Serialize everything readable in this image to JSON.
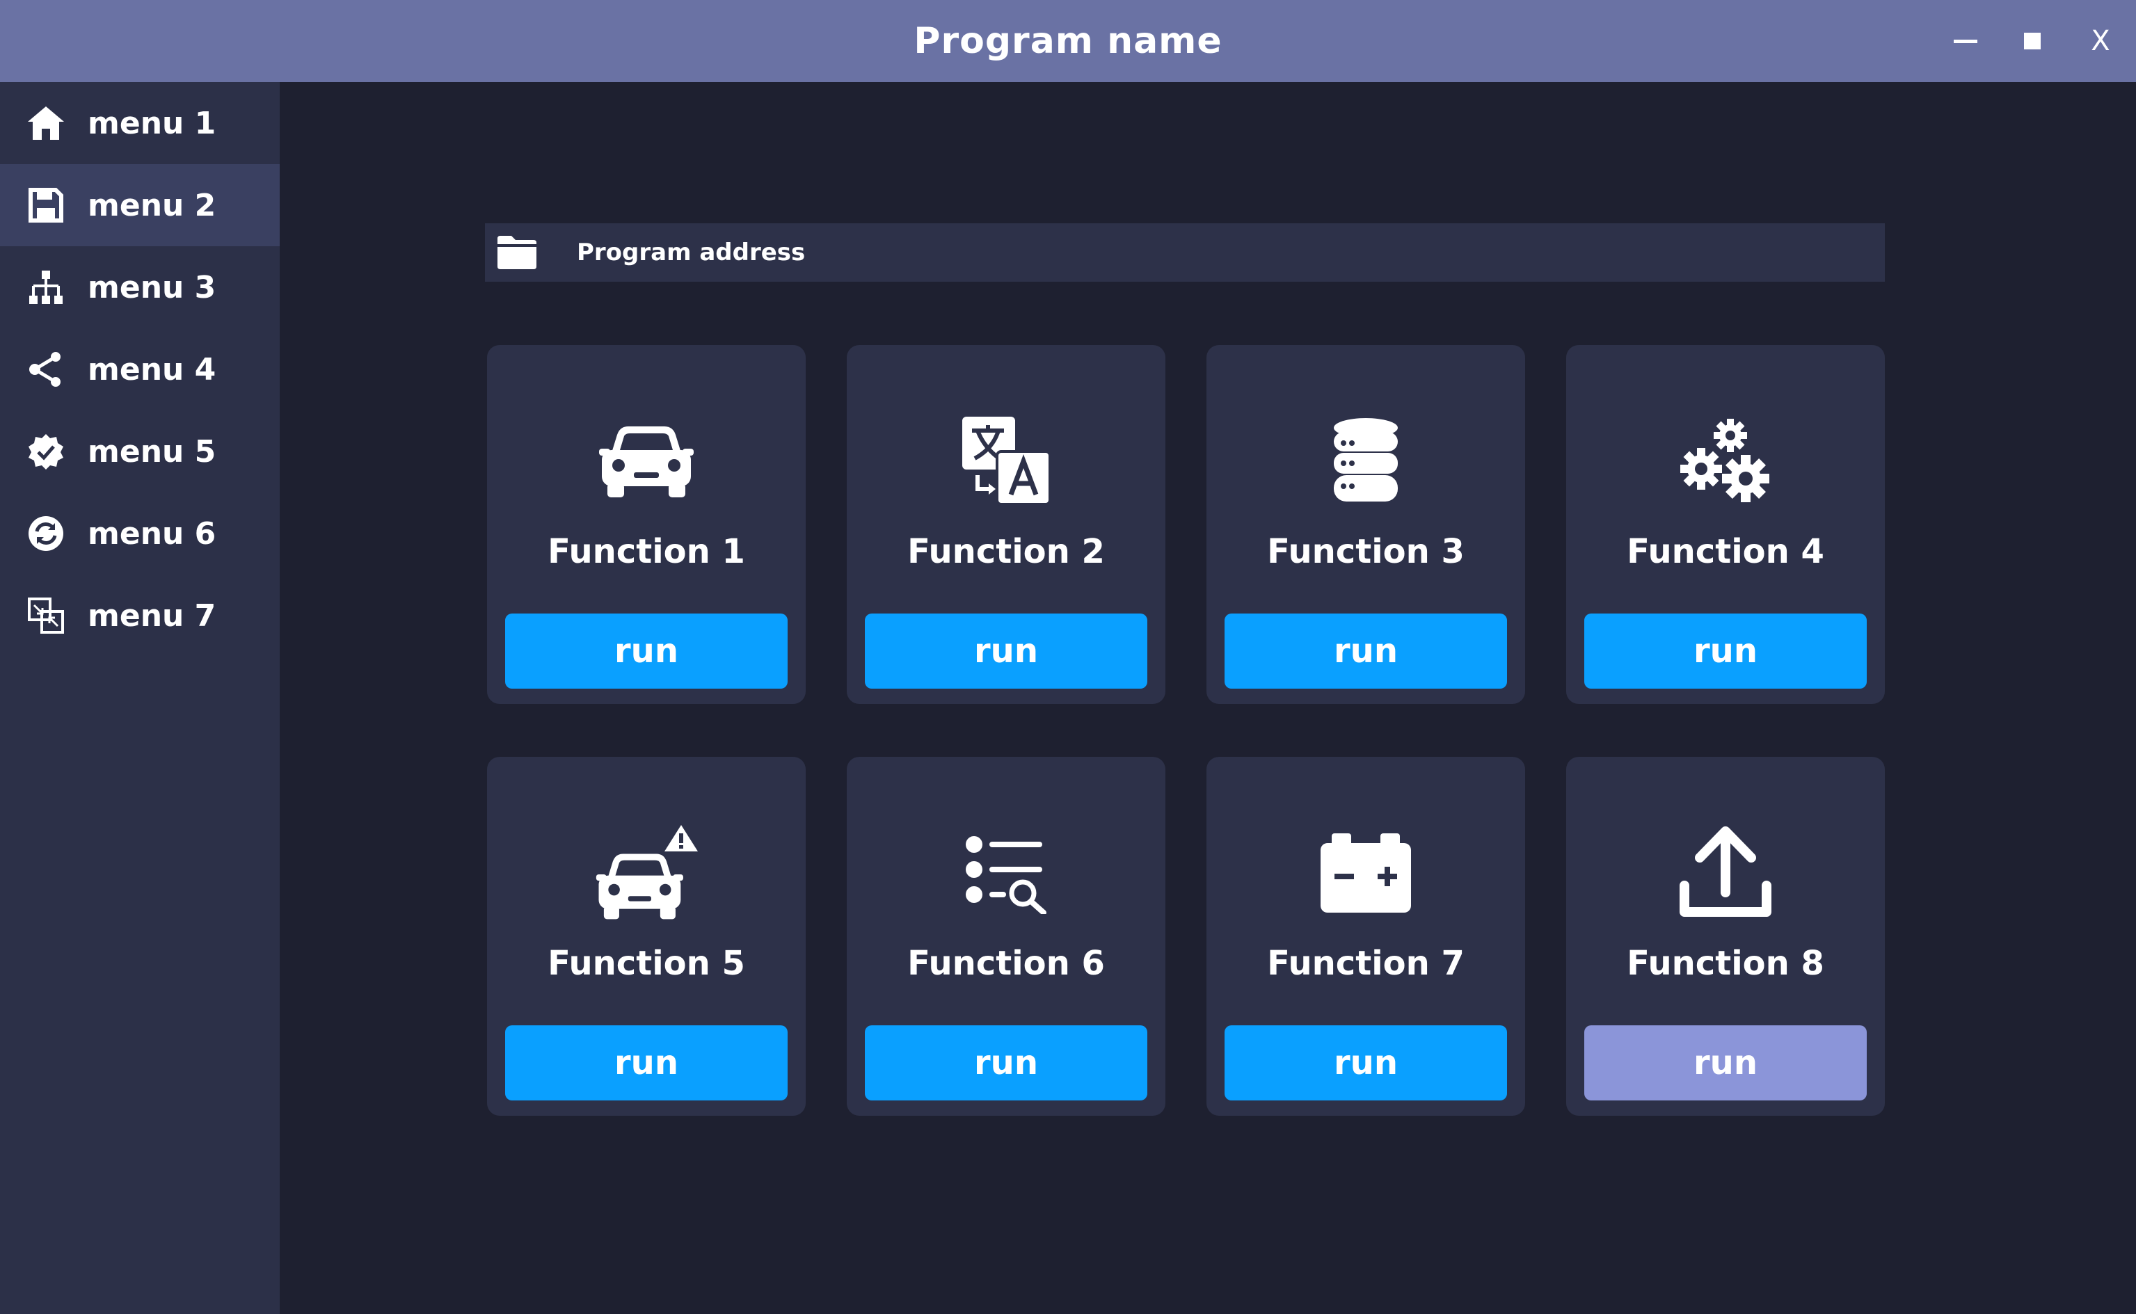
{
  "window": {
    "title": "Program name",
    "controls": {
      "minimize": "—",
      "maximize": "■",
      "close": "X"
    }
  },
  "sidebar": {
    "items": [
      {
        "label": "menu 1",
        "icon": "home-icon",
        "active": false
      },
      {
        "label": "menu 2",
        "icon": "save-icon",
        "active": true
      },
      {
        "label": "menu 3",
        "icon": "sitemap-icon",
        "active": false
      },
      {
        "label": "menu 4",
        "icon": "share-icon",
        "active": false
      },
      {
        "label": "menu 5",
        "icon": "verified-badge-icon",
        "active": false
      },
      {
        "label": "menu 6",
        "icon": "sync-icon",
        "active": false
      },
      {
        "label": "menu 7",
        "icon": "transfer-icon",
        "active": false
      }
    ]
  },
  "address_bar": {
    "icon": "folder-icon",
    "text": "Program address"
  },
  "functions": [
    {
      "label": "Function 1",
      "icon": "car-icon",
      "button": "run",
      "enabled": true
    },
    {
      "label": "Function 2",
      "icon": "translate-icon",
      "button": "run",
      "enabled": true
    },
    {
      "label": "Function 3",
      "icon": "database-icon",
      "button": "run",
      "enabled": true
    },
    {
      "label": "Function 4",
      "icon": "gears-icon",
      "button": "run",
      "enabled": true
    },
    {
      "label": "Function 5",
      "icon": "car-warning-icon",
      "button": "run",
      "enabled": true
    },
    {
      "label": "Function 6",
      "icon": "list-search-icon",
      "button": "run",
      "enabled": true
    },
    {
      "label": "Function 7",
      "icon": "battery-icon",
      "button": "run",
      "enabled": true
    },
    {
      "label": "Function 8",
      "icon": "upload-icon",
      "button": "run",
      "enabled": false
    }
  ],
  "colors": {
    "titlebar": "#6a72a4",
    "sidebar": "#2c3048",
    "sidebar_active": "#3a4061",
    "background": "#1e2030",
    "card": "#2d3149",
    "run_button": "#0aa0ff",
    "run_button_disabled": "#8b95d9"
  }
}
